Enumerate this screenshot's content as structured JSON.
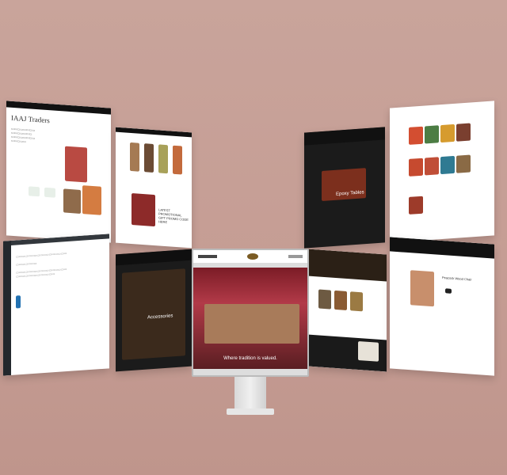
{
  "panels": {
    "left_top_title": "IAAJ Traders",
    "center_left_headline": "LATEST PROMOTIONAL GIFT PROMO CODE HERE",
    "left_mid_title": "Accessories",
    "right_top_title": "Epoxy Tables",
    "right_mid_title": "Peacock Wood Chair"
  },
  "monitor": {
    "hero_text": "Where tradition is valued."
  }
}
